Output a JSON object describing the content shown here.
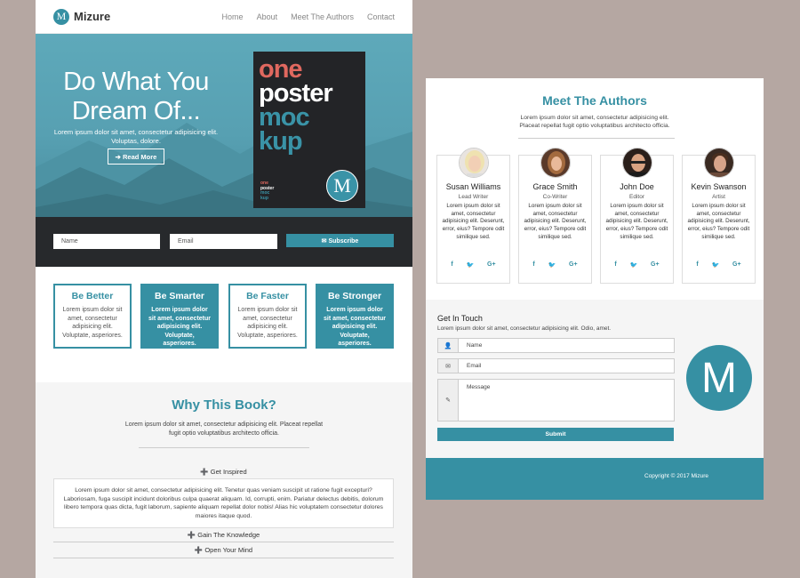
{
  "colors": {
    "accent": "#3690a3",
    "dark_bar": "#27292c",
    "background": "#b5a7a2"
  },
  "left_page": {
    "brand": {
      "logo_letter": "M",
      "name": "Mizure"
    },
    "nav": [
      "Home",
      "About",
      "Meet The Authors",
      "Contact"
    ],
    "hero": {
      "title_line1": "Do What You",
      "title_line2": "Dream Of...",
      "subtitle": "Lorem ipsum dolor sit amet, consectetur adipisicing elit. Voluptas, dolore.",
      "button": "➔ Read More",
      "poster": {
        "word1": "one",
        "word2": "poster",
        "word3": "moc",
        "word4": "kup",
        "mini1": "one",
        "mini2": "poster",
        "mini3": "moc",
        "mini4": "kup",
        "logo_letter": "M"
      }
    },
    "subscribe": {
      "name_placeholder": "Name",
      "email_placeholder": "Email",
      "button": "✉ Subscribe"
    },
    "features": [
      {
        "title": "Be Better",
        "text": "Lorem ipsum dolor sit amet, consectetur adipisicing elit. Voluptate, asperiores."
      },
      {
        "title": "Be Smarter",
        "text": "Lorem ipsum dolor sit amet, consectetur adipisicing elit. Voluptate, asperiores."
      },
      {
        "title": "Be Faster",
        "text": "Lorem ipsum dolor sit amet, consectetur adipisicing elit. Voluptate, asperiores."
      },
      {
        "title": "Be Stronger",
        "text": "Lorem ipsum dolor sit amet, consectetur adipisicing elit. Voluptate, asperiores."
      }
    ],
    "why": {
      "title": "Why This Book?",
      "intro": "Lorem ipsum dolor sit amet, consectetur adipisicing elit. Placeat repellat fugit optio voluptatibus architecto officia.",
      "accordion": [
        {
          "label": "➕ Get Inspired",
          "body": "Lorem ipsum dolor sit amet, consectetur adipisicing elit. Tenetur quas veniam suscipit ut ratione fugit excepturi? Laboriosam, fuga suscipit incidunt doloribus culpa quaerat aliquam. Id, corrupti, enim. Pariatur delectus debitis, dolorum libero tempora quas dicta, fugit laborum, sapiente aliquam repellat dolor nobis! Alias hic voluptatem consectetur dolores maiores itaque quod."
        },
        {
          "label": "➕ Gain The Knowledge"
        },
        {
          "label": "➕ Open Your Mind"
        }
      ]
    }
  },
  "right_page": {
    "authors_title": "Meet The Authors",
    "authors_intro": "Lorem ipsum dolor sit amet, consectetur adipisicing elit. Placeat repellat fugit optio voluptatibus architecto officia.",
    "authors": [
      {
        "name": "Susan Williams",
        "role": "Lead Writer",
        "bio": "Lorem ipsum dolor sit amet, consectetur adipisicing elit. Deserunt, error, eius? Tempore odit similique sed."
      },
      {
        "name": "Grace Smith",
        "role": "Co-Writer",
        "bio": "Lorem ipsum dolor sit amet, consectetur adipisicing elit. Deserunt, error, eius? Tempore odit similique sed."
      },
      {
        "name": "John Doe",
        "role": "Editor",
        "bio": "Lorem ipsum dolor sit amet, consectetur adipisicing elit. Deserunt, error, eius? Tempore odit similique sed."
      },
      {
        "name": "Kevin Swanson",
        "role": "Artist",
        "bio": "Lorem ipsum dolor sit amet, consectetur adipisicing elit. Deserunt, error, eius? Tempore odit similique sed."
      }
    ],
    "social": {
      "facebook": "f",
      "twitter": "🐦",
      "google": "G+"
    },
    "contact": {
      "title": "Get In Touch",
      "subtitle": "Lorem ipsum dolor sit amet, consectetur adipisicing elit. Odio, amet.",
      "name_placeholder": "Name",
      "email_placeholder": "Email",
      "message_placeholder": "Message",
      "button": "Submit",
      "logo_letter": "M",
      "icons": {
        "name": "👤",
        "email": "✉",
        "message": "✎"
      }
    },
    "footer": "Copyright © 2017 Mizure"
  }
}
